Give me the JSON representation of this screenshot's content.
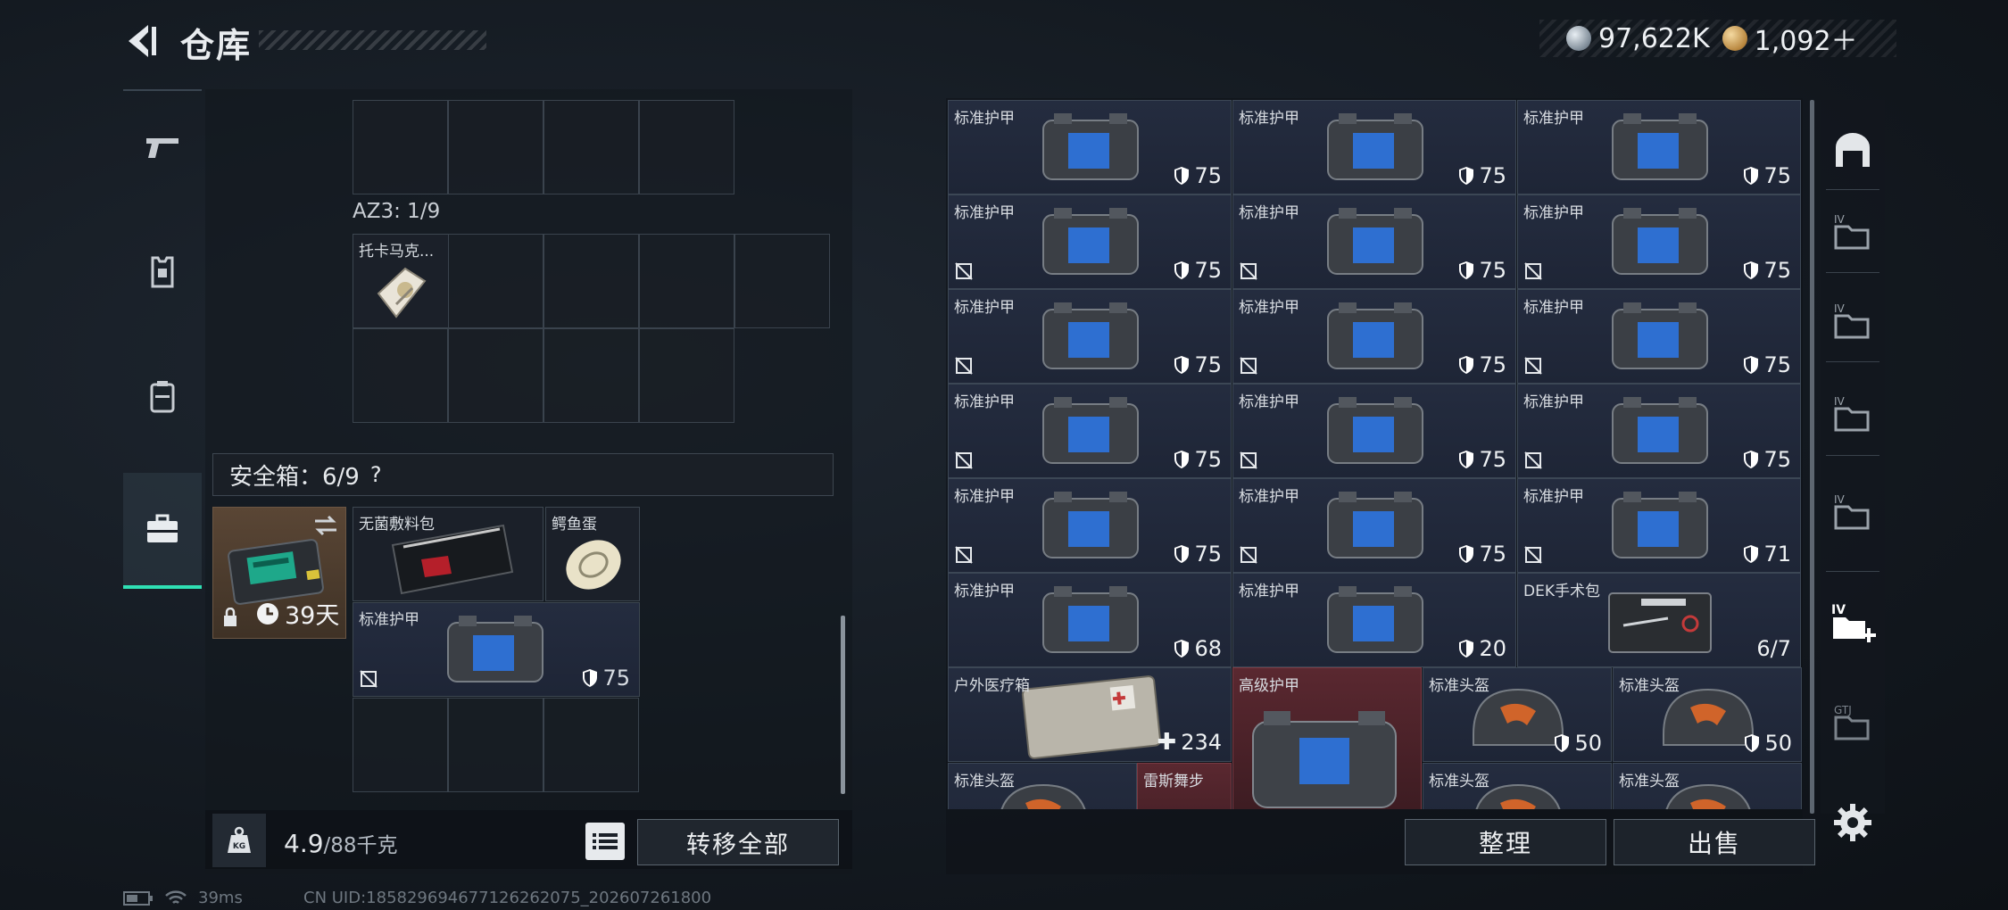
{
  "header": {
    "title": "仓库",
    "silver_amount": "97,622K",
    "gold_amount": "1,092＋"
  },
  "side_tabs": [
    {
      "icon": "pistol-icon"
    },
    {
      "icon": "armor-vest-icon"
    },
    {
      "icon": "backpack-icon"
    },
    {
      "icon": "safebox-icon",
      "active": true
    }
  ],
  "left_panel": {
    "az3_label": "AZ3: 1/9",
    "az3_item": "托卡马克...",
    "safebox_label": "安全箱：6/9",
    "safebox_help": "?",
    "safebox_days": "39天",
    "safebox_items": [
      {
        "name": "无菌敷料包"
      },
      {
        "name": "鳄鱼蛋"
      },
      {
        "name": "标准护甲",
        "value": "75"
      }
    ],
    "weight": "4.9",
    "weight_max": "/88千克",
    "transfer_all": "转移全部"
  },
  "stash": {
    "rows": [
      [
        {
          "name": "标准护甲",
          "value": "75",
          "noenter": false
        },
        {
          "name": "标准护甲",
          "value": "75",
          "noenter": false
        },
        {
          "name": "标准护甲",
          "value": "75",
          "noenter": false
        }
      ],
      [
        {
          "name": "标准护甲",
          "value": "75",
          "noenter": true
        },
        {
          "name": "标准护甲",
          "value": "75",
          "noenter": true
        },
        {
          "name": "标准护甲",
          "value": "75",
          "noenter": true
        }
      ],
      [
        {
          "name": "标准护甲",
          "value": "75",
          "noenter": true
        },
        {
          "name": "标准护甲",
          "value": "75",
          "noenter": true
        },
        {
          "name": "标准护甲",
          "value": "75",
          "noenter": true
        }
      ],
      [
        {
          "name": "标准护甲",
          "value": "75",
          "noenter": true
        },
        {
          "name": "标准护甲",
          "value": "75",
          "noenter": true
        },
        {
          "name": "标准护甲",
          "value": "75",
          "noenter": true
        }
      ],
      [
        {
          "name": "标准护甲",
          "value": "75",
          "noenter": true
        },
        {
          "name": "标准护甲",
          "value": "75",
          "noenter": true
        },
        {
          "name": "标准护甲",
          "value": "71",
          "noenter": true
        }
      ],
      [
        {
          "name": "标准护甲",
          "value": "68",
          "noenter": false
        },
        {
          "name": "标准护甲",
          "value": "20",
          "noenter": false
        },
        {
          "name": "DEK手术包",
          "value": "6/7",
          "noenter": false
        }
      ]
    ],
    "outdoor_kit": {
      "name": "户外医疗箱",
      "value": "234"
    },
    "advanced_armor": {
      "name": "高级护甲"
    },
    "helmets": [
      {
        "name": "标准头盔",
        "value": "50"
      },
      {
        "name": "标准头盔",
        "value": "50"
      }
    ],
    "partial_row": [
      {
        "name": "标准头盔"
      },
      {
        "name": "雷斯舞步"
      },
      {
        "name": "标准头盔"
      },
      {
        "name": "标准头盔"
      }
    ],
    "sort_label": "整理",
    "sell_label": "出售"
  },
  "status": {
    "ping": "39ms",
    "uid": "CN UID:185829694677126262075_202607261800"
  }
}
